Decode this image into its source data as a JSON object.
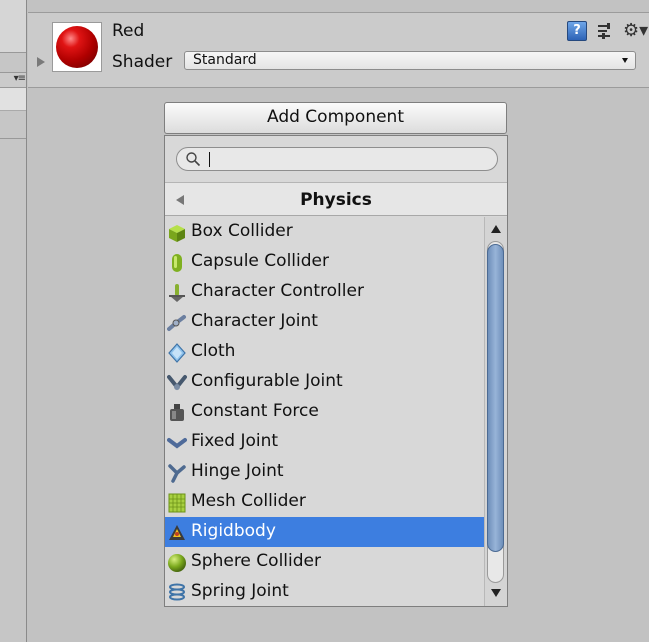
{
  "material": {
    "name": "Red",
    "shader_label": "Shader",
    "shader_value": "Standard",
    "header_icons": [
      "help-icon",
      "preset-icon",
      "gear-icon"
    ]
  },
  "add_component": {
    "label": "Add Component",
    "search_value": "",
    "category": "Physics",
    "items": [
      {
        "label": "Box Collider",
        "icon": "box-collider-icon"
      },
      {
        "label": "Capsule Collider",
        "icon": "capsule-collider-icon"
      },
      {
        "label": "Character Controller",
        "icon": "character-controller-icon"
      },
      {
        "label": "Character Joint",
        "icon": "character-joint-icon"
      },
      {
        "label": "Cloth",
        "icon": "cloth-icon"
      },
      {
        "label": "Configurable Joint",
        "icon": "configurable-joint-icon"
      },
      {
        "label": "Constant Force",
        "icon": "constant-force-icon"
      },
      {
        "label": "Fixed Joint",
        "icon": "fixed-joint-icon"
      },
      {
        "label": "Hinge Joint",
        "icon": "hinge-joint-icon"
      },
      {
        "label": "Mesh Collider",
        "icon": "mesh-collider-icon"
      },
      {
        "label": "Rigidbody",
        "icon": "rigidbody-icon",
        "selected": true
      },
      {
        "label": "Sphere Collider",
        "icon": "sphere-collider-icon"
      },
      {
        "label": "Spring Joint",
        "icon": "spring-joint-icon"
      }
    ],
    "selected_color": "#3d7ee0"
  }
}
